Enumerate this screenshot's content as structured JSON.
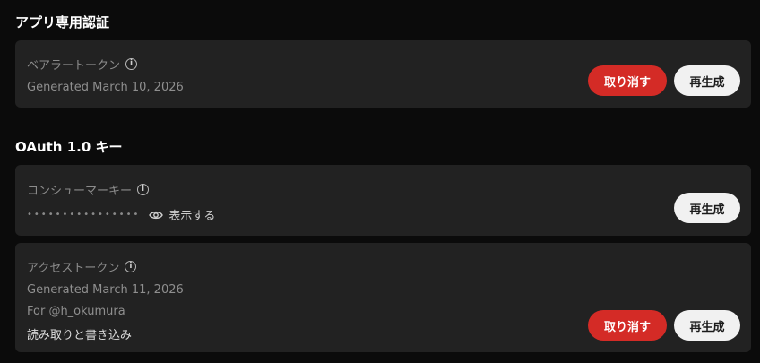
{
  "app_auth": {
    "title": "アプリ専用認証",
    "bearer": {
      "label": "ベアラートークン",
      "generated": "Generated March 10, 2026",
      "revoke_label": "取り消す",
      "regenerate_label": "再生成"
    }
  },
  "oauth": {
    "title": "OAuth 1.0 キー",
    "consumer": {
      "label": "コンシューマーキー",
      "masked_value": "••••••••••••••••",
      "show_label": "表示する",
      "regenerate_label": "再生成"
    },
    "access": {
      "label": "アクセストークン",
      "generated": "Generated March 11, 2026",
      "for_user": "For @h_okumura",
      "permission": "読み取りと書き込み",
      "revoke_label": "取り消す",
      "regenerate_label": "再生成"
    }
  },
  "icons": {
    "info": "info-icon",
    "eye": "eye-icon"
  },
  "colors": {
    "background": "#0b0b0b",
    "card": "#222222",
    "revoke": "#d42b26",
    "regenerate": "#f1f1f1"
  }
}
